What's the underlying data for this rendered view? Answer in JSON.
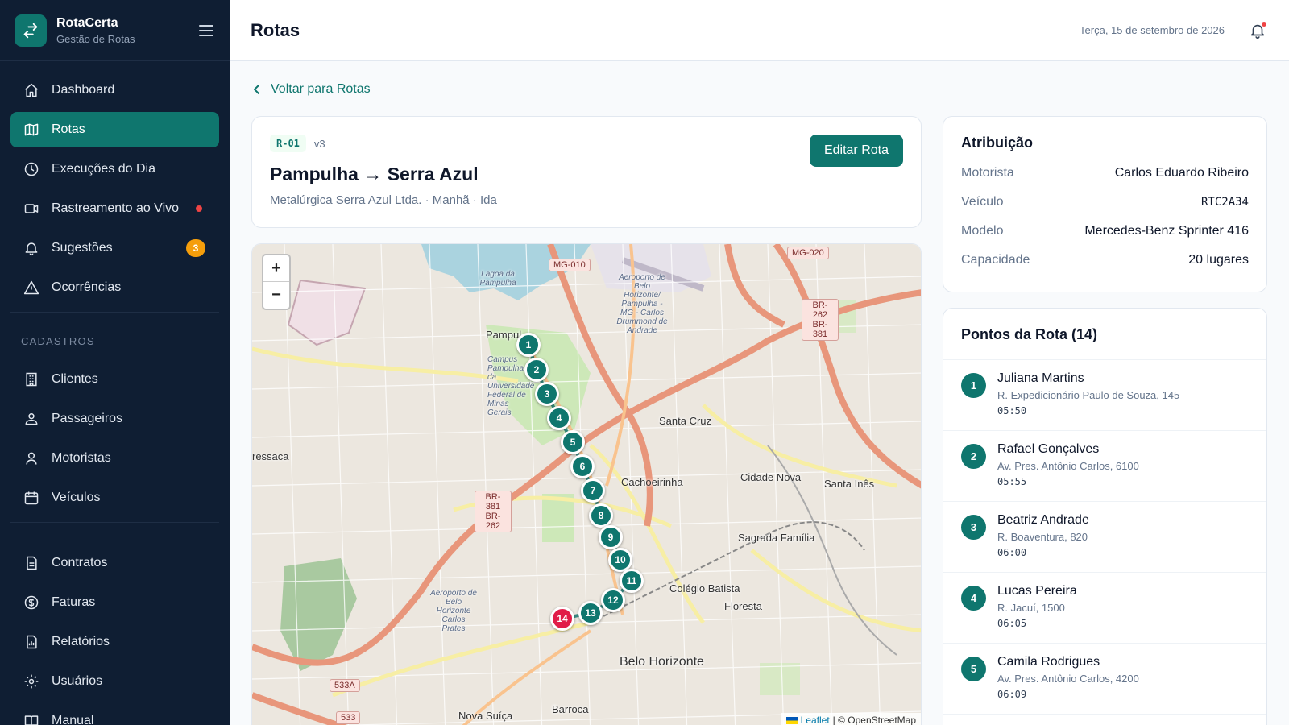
{
  "app": {
    "name": "RotaCerta",
    "subtitle": "Gestão de Rotas"
  },
  "colors": {
    "sidebar": "#0f1e33",
    "accent": "#0f766e",
    "danger": "#e11d48",
    "warning": "#f59e0b"
  },
  "sidebar": {
    "items": [
      {
        "label": "Dashboard",
        "icon": "home-icon"
      },
      {
        "label": "Rotas",
        "icon": "map-icon",
        "active": true
      },
      {
        "label": "Execuções do Dia",
        "icon": "clock-icon"
      },
      {
        "label": "Rastreamento ao Vivo",
        "icon": "video-icon",
        "live": true
      },
      {
        "label": "Sugestões",
        "icon": "bell-icon",
        "badge": "3"
      },
      {
        "label": "Ocorrências",
        "icon": "warning-icon"
      }
    ],
    "section_label": "CADASTROS",
    "cadastros": [
      {
        "label": "Clientes",
        "icon": "building-icon"
      },
      {
        "label": "Passageiros",
        "icon": "users-icon"
      },
      {
        "label": "Motoristas",
        "icon": "user-icon"
      },
      {
        "label": "Veículos",
        "icon": "calendar-icon"
      }
    ],
    "bottom": [
      {
        "label": "Contratos",
        "icon": "document-icon"
      },
      {
        "label": "Faturas",
        "icon": "dollar-icon"
      },
      {
        "label": "Relatórios",
        "icon": "report-icon"
      },
      {
        "label": "Usuários",
        "icon": "gear-icon"
      },
      {
        "label": "Manual",
        "icon": "book-icon"
      }
    ]
  },
  "header": {
    "title": "Rotas",
    "date": "Terça, 15 de setembro de 2026"
  },
  "back_link": "Voltar para Rotas",
  "route": {
    "code": "R-01",
    "version": "v3",
    "title": "Pampulha → Serra Azul",
    "subtitle": "Metalúrgica Serra Azul Ltda. · Manhã · Ida",
    "edit_label": "Editar Rota"
  },
  "map": {
    "zoom_in": "+",
    "zoom_out": "−",
    "attribution_leaflet": "Leaflet",
    "attribution_rest": "| © OpenStreetMap",
    "labels": {
      "pampulha": "Pampul",
      "lagoa": "Lagoa da Pampulha",
      "aeroporto": "Aeroporto de Belo Horizonte/ Pampulha - MG - Carlos Drummond de Andrade",
      "campus": "Campus Pampulha da Universidade Federal de Minas Gerais",
      "santa_cruz": "Santa Cruz",
      "cachoeirinha": "Cachoeirinha",
      "cidade_nova": "Cidade Nova",
      "santa_ines": "Santa Inês",
      "sagrada": "Sagrada Família",
      "colegio": "Colégio Batista",
      "floresta": "Floresta",
      "bh": "Belo Horizonte",
      "nova_suica": "Nova Suíça",
      "barroca": "Barroca",
      "ressaca": "ressaca",
      "aero2": "Aeroporto de Belo Horizonte Carlos Prates",
      "mg010": "MG-010",
      "mg020": "MG-020",
      "br262a": "BR-262 BR-381",
      "br381a": "BR-381 BR-262",
      "r533": "533A",
      "r533b": "533"
    },
    "markers": [
      "1",
      "2",
      "3",
      "4",
      "5",
      "6",
      "7",
      "8",
      "9",
      "10",
      "11",
      "12",
      "13",
      "14"
    ]
  },
  "assignment": {
    "title": "Atribuição",
    "rows": [
      {
        "key": "Motorista",
        "value": "Carlos Eduardo Ribeiro"
      },
      {
        "key": "Veículo",
        "value": "RTC2A34"
      },
      {
        "key": "Modelo",
        "value": "Mercedes-Benz Sprinter 416"
      },
      {
        "key": "Capacidade",
        "value": "20 lugares"
      }
    ]
  },
  "stops": {
    "title": "Pontos da Rota (14)",
    "items": [
      {
        "num": "1",
        "name": "Juliana Martins",
        "address": "R. Expedicionário Paulo de Souza, 145",
        "time": "05:50"
      },
      {
        "num": "2",
        "name": "Rafael Gonçalves",
        "address": "Av. Pres. Antônio Carlos, 6100",
        "time": "05:55"
      },
      {
        "num": "3",
        "name": "Beatriz Andrade",
        "address": "R. Boaventura, 820",
        "time": "06:00"
      },
      {
        "num": "4",
        "name": "Lucas Pereira",
        "address": "R. Jacuí, 1500",
        "time": "06:05"
      },
      {
        "num": "5",
        "name": "Camila Rodrigues",
        "address": "Av. Pres. Antônio Carlos, 4200",
        "time": "06:09"
      }
    ]
  }
}
